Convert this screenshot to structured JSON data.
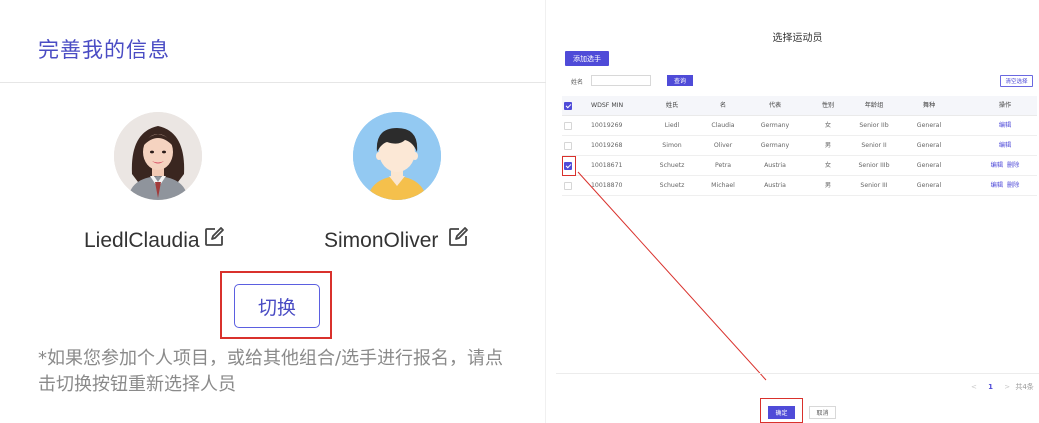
{
  "left": {
    "title": "完善我的信息",
    "athletes": [
      {
        "name": "LiedlClaudia"
      },
      {
        "name": "SimonOliver"
      }
    ],
    "switch_label": "切换",
    "hint": "*如果您参加个人项目，或给其他组合/选手进行报名，请点击切换按钮重新选择人员"
  },
  "right": {
    "title": "选择运动员",
    "add_label": "添加选手",
    "name_label": "姓名",
    "search_label": "查询",
    "clear_label": "清空选择",
    "columns": [
      "WDSF MIN",
      "姓氏",
      "名",
      "代表",
      "性别",
      "年龄组",
      "舞种",
      "操作"
    ],
    "rows": [
      {
        "id": "10019269",
        "last": "Liedl",
        "first": "Claudia",
        "rep": "Germany",
        "gender": "女",
        "age": "Senior IIb",
        "dance": "General",
        "ops": [
          "编辑"
        ],
        "checked": false
      },
      {
        "id": "10019268",
        "last": "Simon",
        "first": "Oliver",
        "rep": "Germany",
        "gender": "男",
        "age": "Senior II",
        "dance": "General",
        "ops": [
          "编辑"
        ],
        "checked": false
      },
      {
        "id": "10018671",
        "last": "Schuetz",
        "first": "Petra",
        "rep": "Austria",
        "gender": "女",
        "age": "Senior IIIb",
        "dance": "General",
        "ops": [
          "编辑",
          "删除"
        ],
        "checked": true
      },
      {
        "id": "10018870",
        "last": "Schuetz",
        "first": "Michael",
        "rep": "Austria",
        "gender": "男",
        "age": "Senior III",
        "dance": "General",
        "ops": [
          "编辑",
          "删除"
        ],
        "checked": false
      }
    ],
    "header_checked": true,
    "pager": {
      "prev": "<",
      "current": "1",
      "next": ">",
      "total": "共4条"
    },
    "confirm_label": "确定",
    "cancel_label": "取消"
  },
  "colors": {
    "accent": "#4f4bd8",
    "highlight": "#d9312c",
    "title": "#4a4cc4"
  }
}
